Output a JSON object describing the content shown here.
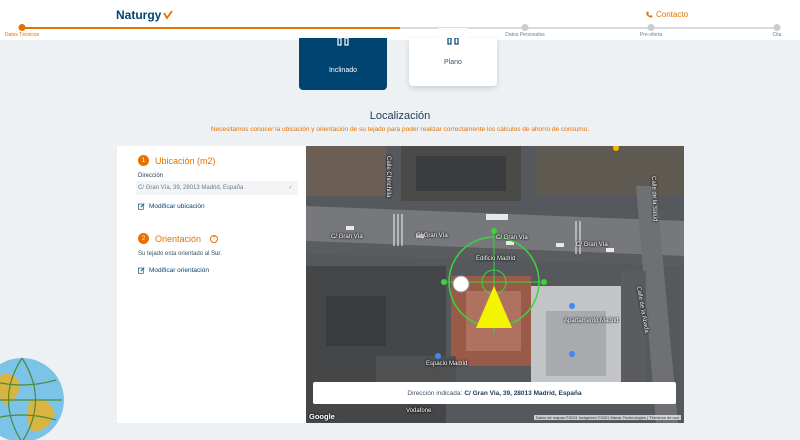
{
  "header": {
    "logo": "Naturgy",
    "contact": "Contacto"
  },
  "steps": [
    {
      "label": "Datos Técnicos",
      "active": true
    },
    {
      "label": "Datos Personales",
      "active": false
    },
    {
      "label": "Pre-oferta",
      "active": false
    },
    {
      "label": "Cita",
      "active": false
    }
  ],
  "progress": 0.5,
  "roof_types": {
    "inclinado": "Inclinado",
    "plano": "Plano"
  },
  "location": {
    "title": "Localización",
    "subtitle": "Necesitamos conocer la ubicación y orientación de su tejado para poder realizar correctamente los cálculos de ahorro de consumo."
  },
  "ubicacion": {
    "number": "1",
    "title": "Ubicación (m2)",
    "direccion_label": "Dirección",
    "direccion_value": "C/ Gran Vía, 39, 28013 Madrid, España",
    "modify_link": "Modificar ubicación"
  },
  "orientacion": {
    "number": "2",
    "title": "Orientación",
    "help": "?",
    "text_prefix": "Su tejado esta orientado al",
    "text_value": "Sur.",
    "modify_link": "Modificar orientación"
  },
  "map": {
    "labels": [
      "C/ Gran Vía",
      "C/ Gran Vía",
      "C/ Gran Vía",
      "C/ Gran Vía",
      "Edificio Madrid",
      "Apartamento Madrid",
      "Calle de la Abada",
      "Calle Chinchilla",
      "Calle de la Salud",
      "Vodafone",
      "Espacio Madrid"
    ],
    "address_prefix": "Dirección indicada:",
    "address_value": "C/ Gran Via, 39, 28013 Madrid, España",
    "google": "Google",
    "attribution": "Datos de mapas ©2021 Imágenes ©2021 Maxar Technologies | Términos de uso"
  },
  "colors": {
    "brand_orange": "#e57200",
    "brand_blue": "#004571"
  }
}
